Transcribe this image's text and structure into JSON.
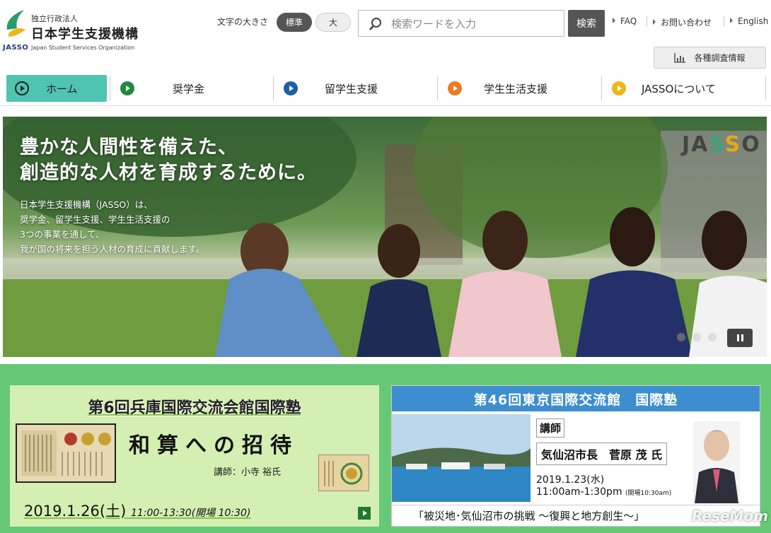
{
  "header": {
    "logo": {
      "sub": "独立行政法人",
      "name": "日本学生支援機構",
      "en": "Japan Student Services Organization",
      "mark": "JASSO"
    },
    "font_size": {
      "label": "文字の大きさ",
      "standard": "標準",
      "large": "大"
    },
    "search": {
      "placeholder": "検索ワードを入力",
      "button": "検索"
    },
    "links": [
      "FAQ",
      "お問い合わせ",
      "English"
    ],
    "survey_button": "各種調査情報"
  },
  "gnav": {
    "items": [
      {
        "label": "ホーム",
        "color": "#4fc4b1",
        "active": true
      },
      {
        "label": "奨学金",
        "color": "#1f8a3a"
      },
      {
        "label": "留学生支援",
        "color": "#1b5fa8"
      },
      {
        "label": "学生生活支援",
        "color": "#ee7a22"
      },
      {
        "label": "JASSOについて",
        "color": "#f1b51c"
      }
    ]
  },
  "hero": {
    "title_line1": "豊かな人間性を備えた、",
    "title_line2": "創造的な人材を育成するために。",
    "desc": [
      "日本学生支援機構（JASSO）は、",
      "奨学金、留学生支援、学生生活支援の",
      "3つの事業を通して、",
      "我が国の将来を担う人材の育成に貢献します。"
    ],
    "logo": "JASSO",
    "slider": {
      "count": 3,
      "active": 0
    }
  },
  "banners": {
    "hyogo": {
      "title": "第6回兵庫国際交流会館国際塾",
      "main": "和算への招待",
      "lecturer": "講師：小寺 裕氏",
      "date": "2019.1.26(土)",
      "time": "11:00-13:30(開場 10:30)"
    },
    "tokyo": {
      "title": "第46回東京国際交流館　国際塾",
      "role": "講師",
      "name": "気仙沼市長　菅原 茂 氏",
      "date": "2019.1.23(水)",
      "time": "11:00am-1:30pm",
      "open": "(開場10:30am)",
      "footer": "「被災地･気仙沼市の挑戦 ～復興と地方創生～」"
    }
  },
  "watermark": "ReseMom"
}
